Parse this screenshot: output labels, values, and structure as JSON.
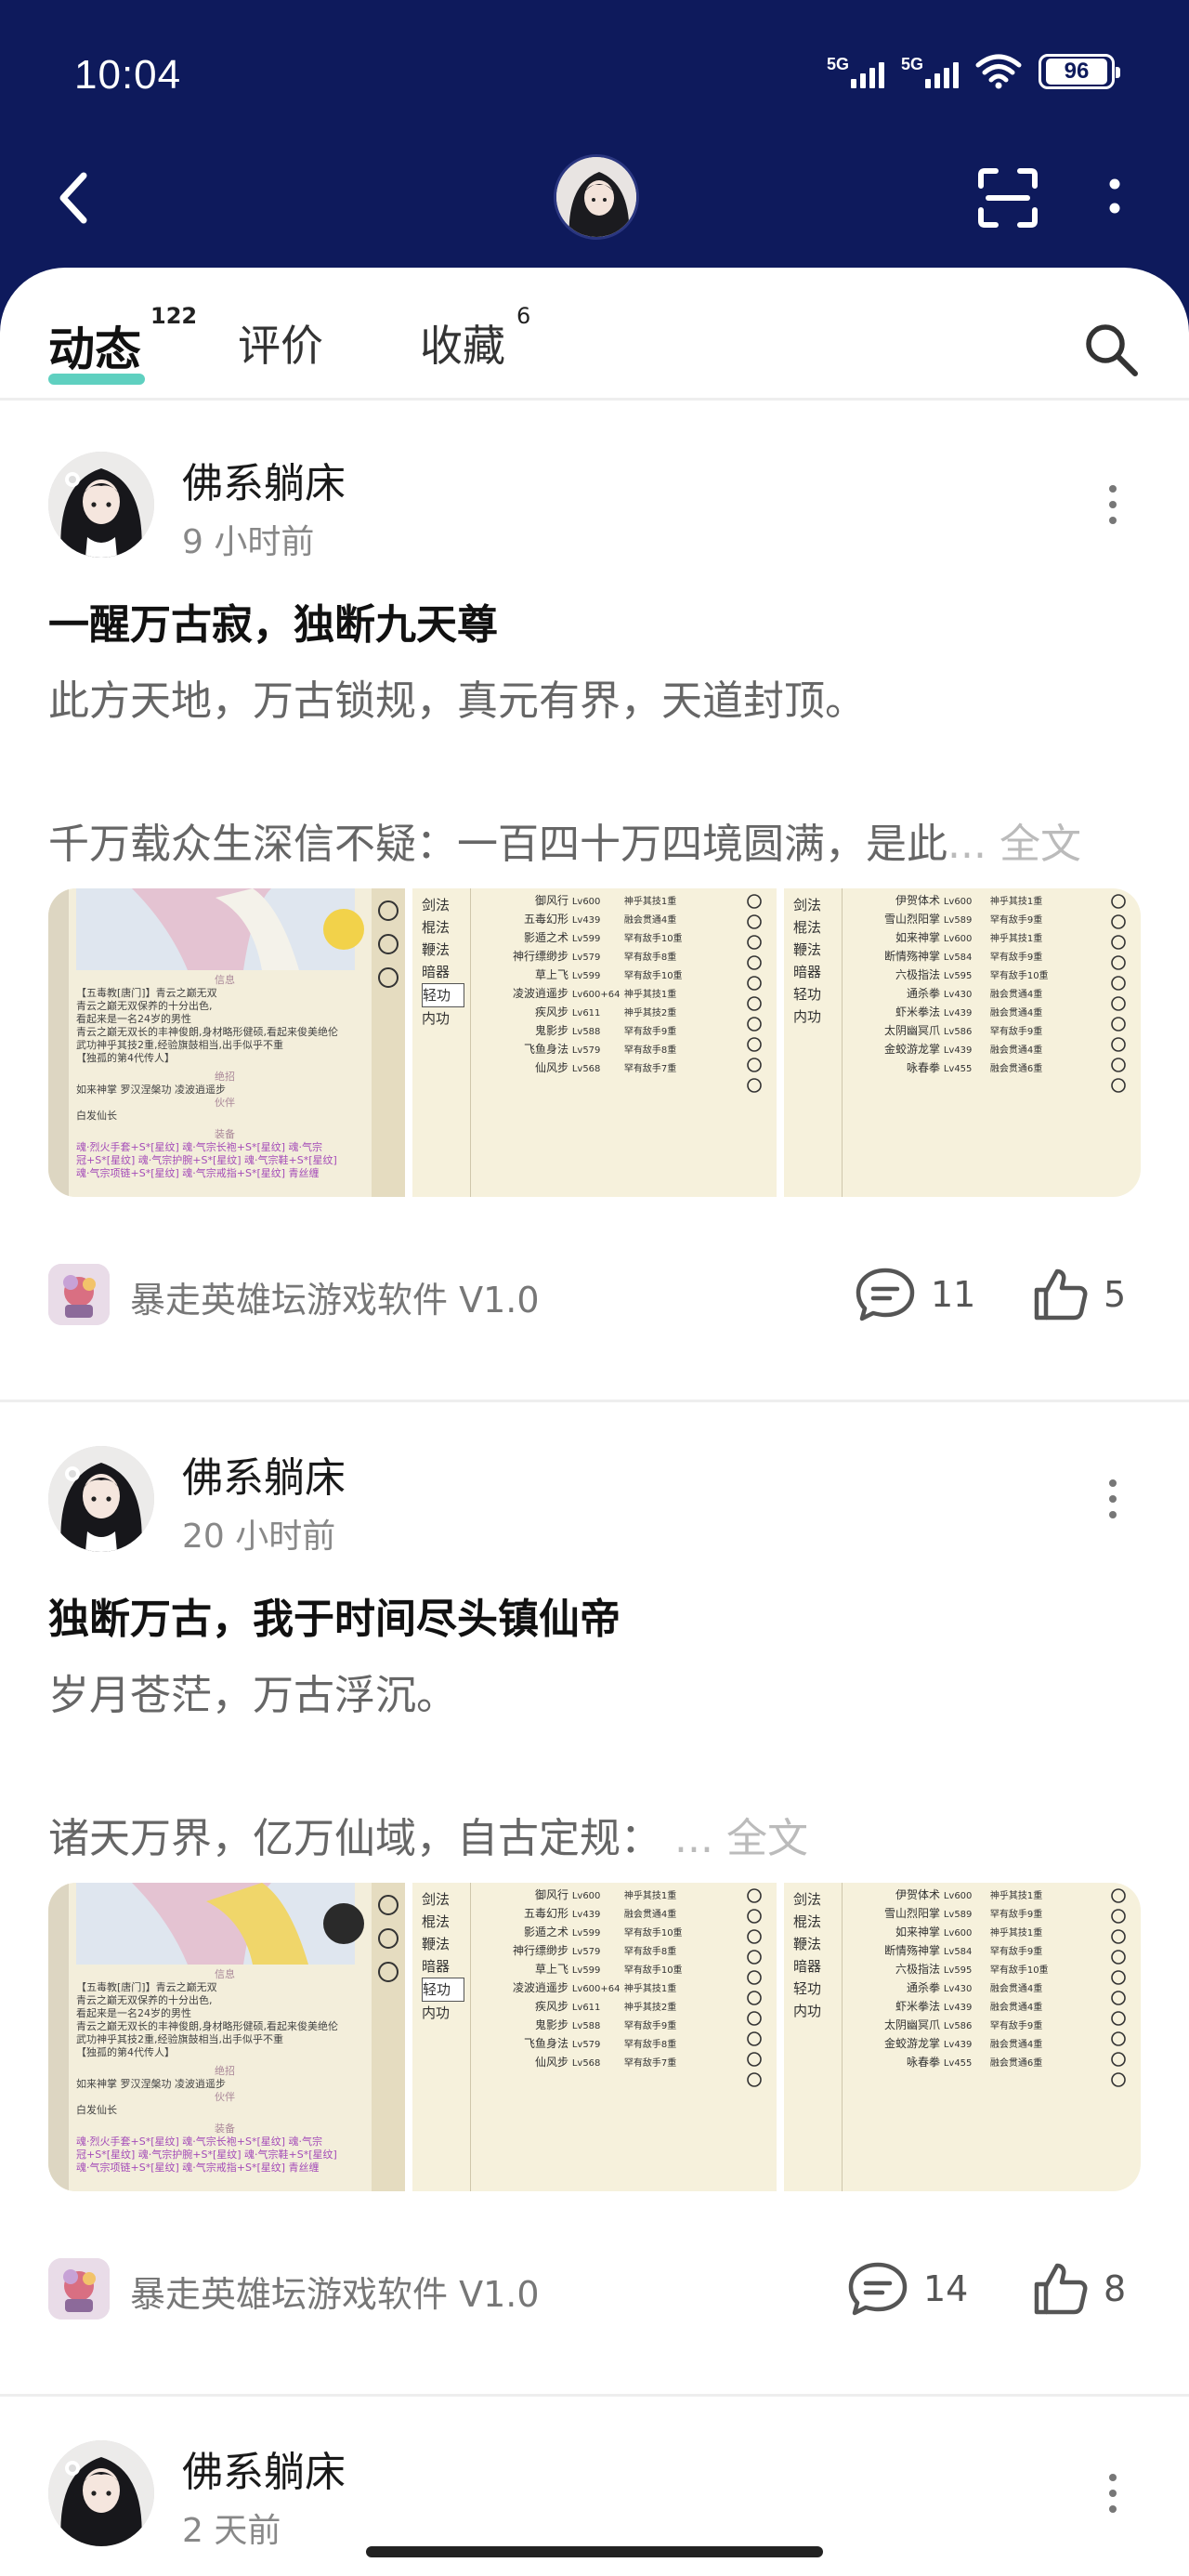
{
  "status": {
    "time": "10:04",
    "signal1_label": "5G",
    "signal2_label": "5G",
    "battery": "96"
  },
  "header": {
    "back_icon": "chevron-left-icon",
    "scan_icon": "scan-icon",
    "more_icon": "more-vertical-icon"
  },
  "tabs": [
    {
      "label": "动态",
      "count": "122"
    },
    {
      "label": "评价",
      "count": ""
    },
    {
      "label": "收藏",
      "count": "6"
    }
  ],
  "posts": [
    {
      "author": "佛系躺床",
      "time": "9 小时前",
      "title": "一醒万古寂，独断九天尊",
      "paragraph1": "此方天地，万古锁规，真元有界，天道封顶。",
      "paragraph2": "千万载众生深信不疑：一百四十万四境圆满，是此",
      "more": "... 全文",
      "app_name": "暴走英雄坛游戏软件 V1.0",
      "comments": "11",
      "likes": "5"
    },
    {
      "author": "佛系躺床",
      "time": "20 小时前",
      "title": "独断万古，我于时间尽头镇仙帝",
      "paragraph1": "岁月苍茫，万古浮沉。",
      "paragraph2": "诸天万界，亿万仙域，自古定规：",
      "more": "... 全文",
      "app_name": "暴走英雄坛游戏软件 V1.0",
      "comments": "14",
      "likes": "8"
    },
    {
      "author": "佛系躺床",
      "time": "2 天前"
    }
  ],
  "screenshot_text": {
    "sect": "【五毒教[唐门]】青云之巅无双",
    "line1": "青云之巅无双保养的十分出色,",
    "line2": "看起来是一名24岁的男性",
    "line3": "青云之巅无双长的丰神俊朗,身材略形健硕,看起来俊美绝伦",
    "line4": "武功神乎其技2重,经验旗鼓相当,出手似乎不重",
    "line5": "【独孤的第4代传人】",
    "sec_info": "信息",
    "sec_skill": "绝招",
    "skills": "如来神掌   罗汉涅槃功   凌波逍遥步",
    "sec_partner": "伙伴",
    "partner": "白发仙长",
    "sec_equip": "装备",
    "equip1": "魂·烈火手套+S*[星纹] 魂·气宗长袍+S*[星纹] 魂·气宗",
    "equip2": "冠+S*[星纹] 魂·气宗护腕+S*[星纹] 魂·气宗鞋+S*[星纹]",
    "equip3": "魂·气宗项链+S*[星纹] 魂·气宗戒指+S*[星纹] 青丝缠",
    "categories_left": [
      "剑法",
      "棍法",
      "鞭法",
      "暗器",
      "轻功",
      "内功"
    ],
    "categories_right": [
      "剑法",
      "棍法",
      "鞭法",
      "暗器",
      "轻功",
      "内功"
    ],
    "list_mid": [
      [
        "御风行",
        "Lv600",
        "神乎其技1重"
      ],
      [
        "五毒幻形",
        "Lv439",
        "融会贯通4重"
      ],
      [
        "影遁之术",
        "Lv599",
        "罕有敌手10重"
      ],
      [
        "神行缥缈步",
        "Lv579",
        "罕有敌手8重"
      ],
      [
        "草上飞",
        "Lv599",
        "罕有敌手10重"
      ],
      [
        "凌波逍遥步",
        "Lv600+64",
        "神乎其技1重"
      ],
      [
        "疾风步",
        "Lv611",
        "神乎其技2重"
      ],
      [
        "鬼影步",
        "Lv588",
        "罕有敌手9重"
      ],
      [
        "飞鱼身法",
        "Lv579",
        "罕有敌手8重"
      ],
      [
        "仙风步",
        "Lv568",
        "罕有敌手7重"
      ]
    ],
    "list_right": [
      [
        "伊贺体术",
        "Lv600",
        "神乎其技1重"
      ],
      [
        "雪山烈阳掌",
        "Lv589",
        "罕有敌手9重"
      ],
      [
        "如来神掌",
        "Lv600",
        "神乎其技1重"
      ],
      [
        "断情殇神掌",
        "Lv584",
        "罕有敌手9重"
      ],
      [
        "六极指法",
        "Lv595",
        "罕有敌手10重"
      ],
      [
        "通杀拳",
        "Lv430",
        "融会贯通4重"
      ],
      [
        "虾米拳法",
        "Lv439",
        "融会贯通4重"
      ],
      [
        "太阴幽冥爪",
        "Lv586",
        "罕有敌手9重"
      ],
      [
        "金蛟游龙掌",
        "Lv439",
        "融会贯通4重"
      ],
      [
        "咏春拳",
        "Lv455",
        "融会贯通6重"
      ]
    ]
  },
  "colors": {
    "header_bg": "#0e1a5c",
    "tab_underline": "#5fd0c0"
  }
}
